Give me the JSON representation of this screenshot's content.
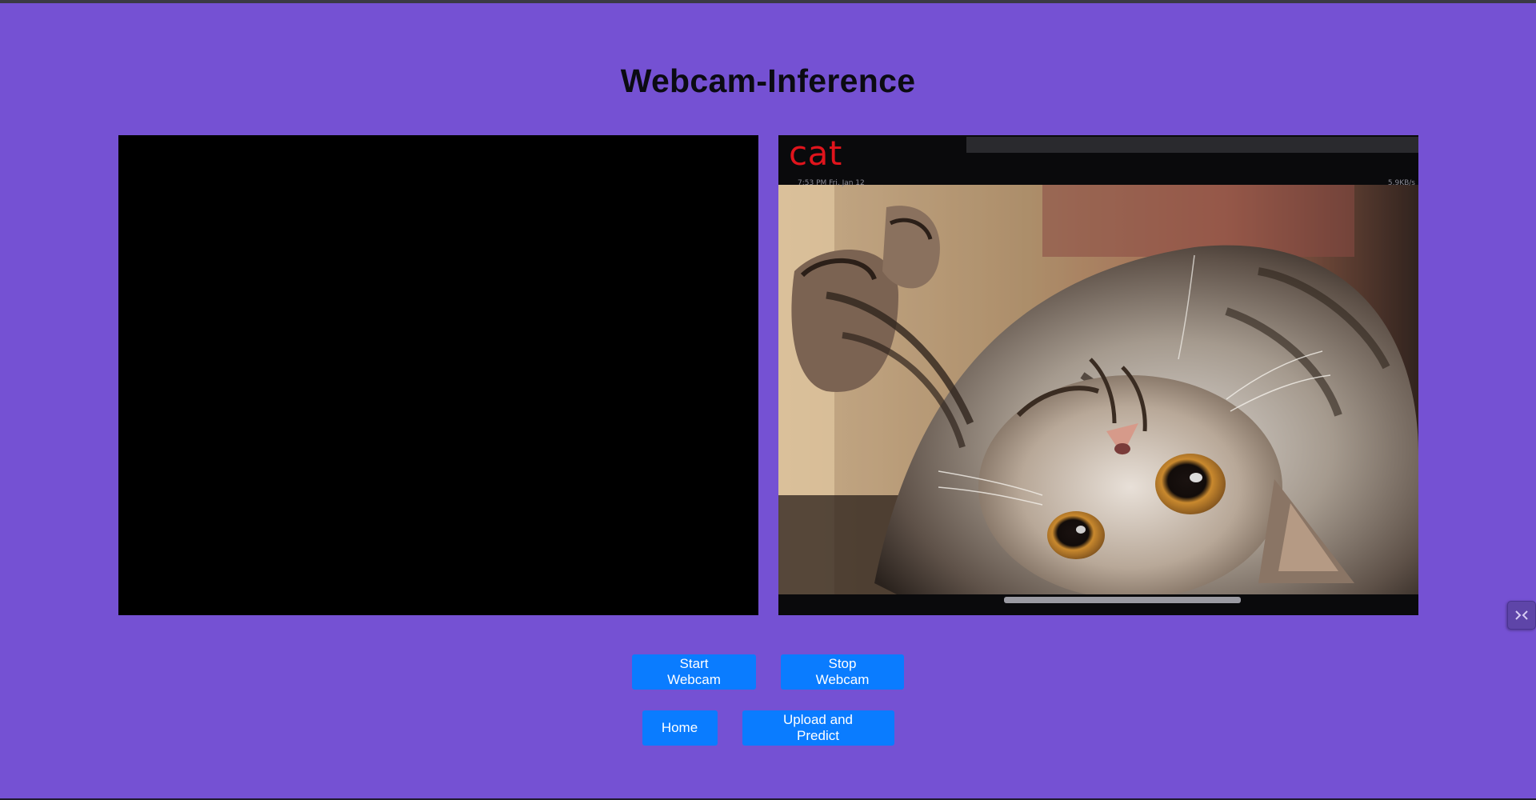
{
  "page": {
    "title": "Webcam-Inference"
  },
  "webcam": {
    "state": "blank"
  },
  "prediction": {
    "label": "cat",
    "label_color": "#e0141c",
    "image": "tabby-cat-lying-on-back",
    "status_left": "7:53 PM Fri, Jan 12",
    "status_right": "5.9KB/s"
  },
  "buttons": {
    "start_webcam": "Start Webcam",
    "stop_webcam": "Stop Webcam",
    "home": "Home",
    "upload_predict": "Upload and Predict"
  },
  "colors": {
    "background": "#7551d3",
    "button": "#0a7cff",
    "button_text": "#ffffff",
    "title": "#0b0b12"
  },
  "widget": {
    "icon": "collapse-arrows-icon"
  }
}
